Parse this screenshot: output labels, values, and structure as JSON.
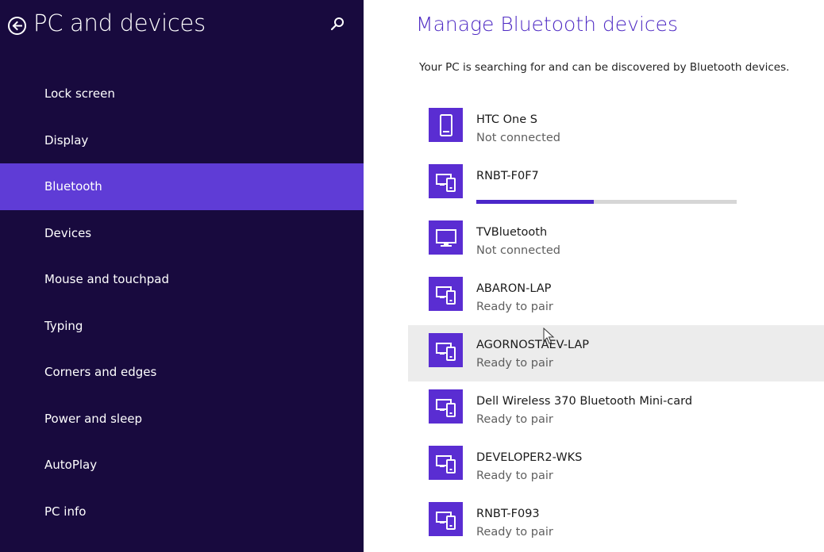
{
  "sidebar": {
    "title": "PC and devices",
    "back_icon": "back-arrow-icon",
    "search_icon": "search-icon",
    "items": [
      {
        "label": "Lock screen"
      },
      {
        "label": "Display"
      },
      {
        "label": "Bluetooth"
      },
      {
        "label": "Devices"
      },
      {
        "label": "Mouse and touchpad"
      },
      {
        "label": "Typing"
      },
      {
        "label": "Corners and edges"
      },
      {
        "label": "Power and sleep"
      },
      {
        "label": "AutoPlay"
      },
      {
        "label": "PC info"
      }
    ],
    "selected_item": "Bluetooth"
  },
  "main": {
    "heading": "Manage Bluetooth devices",
    "status": "Your PC is searching for and can be discovered by Bluetooth devices.",
    "devices": [
      {
        "name": "HTC One S",
        "status": "Not connected",
        "icon": "phone-icon"
      },
      {
        "name": "RNBT-F0F7",
        "status": "",
        "icon": "pc-and-phone-icon",
        "pairing_progress": 0.45
      },
      {
        "name": "TVBluetooth",
        "status": "Not connected",
        "icon": "monitor-icon"
      },
      {
        "name": "ABARON-LAP",
        "status": "Ready to pair",
        "icon": "pc-and-phone-icon"
      },
      {
        "name": "AGORNOSTAEV-LAP",
        "status": "Ready to pair",
        "icon": "pc-and-phone-icon"
      },
      {
        "name": "Dell Wireless 370 Bluetooth Mini-card",
        "status": "Ready to pair",
        "icon": "pc-and-phone-icon"
      },
      {
        "name": "DEVELOPER2-WKS",
        "status": "Ready to pair",
        "icon": "pc-and-phone-icon"
      },
      {
        "name": "RNBT-F093",
        "status": "Ready to pair",
        "icon": "pc-and-phone-icon"
      }
    ]
  },
  "colors": {
    "sidebar_bg": "#180a3e",
    "sidebar_selected": "#5f3cd6",
    "accent": "#5a2dd2",
    "heading": "#4f2bc4"
  }
}
